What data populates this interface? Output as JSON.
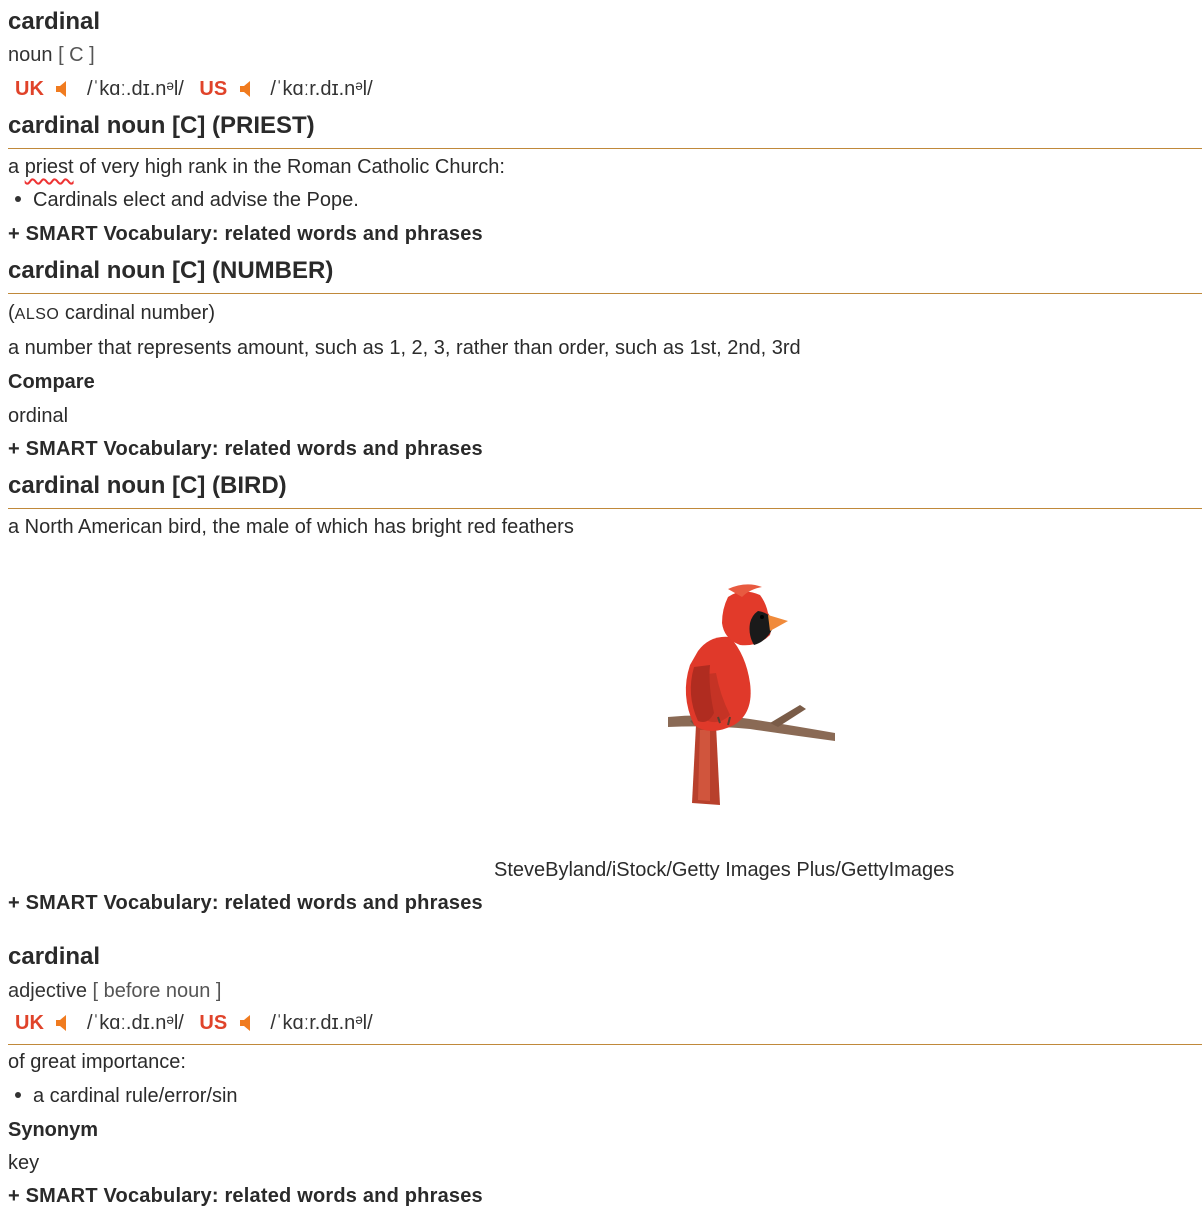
{
  "entry1": {
    "headword": "cardinal",
    "pos": "noun",
    "gram": "[ C ]",
    "uk_label": "UK",
    "uk_ipa": "/ˈkɑː.dɪ.nᵊl/",
    "us_label": "US",
    "us_ipa": "/ˈkɑːr.dɪ.nᵊl/",
    "senses": [
      {
        "heading": "cardinal noun [C] (PRIEST)",
        "def_pre": "a ",
        "def_link": "priest",
        "def_post": " of very high rank in the Roman Catholic Church:",
        "example": "Cardinals elect and advise the Pope.",
        "smart": "+ SMART Vocabulary: related words and phrases"
      },
      {
        "heading": "cardinal noun [C] (NUMBER)",
        "also_open": "(",
        "also_key": "ALSO",
        "also_rest": " cardinal number)",
        "definition": "a number that represents amount, such as 1, 2, 3, rather than order, such as 1st, 2nd, 3rd",
        "compare_label": "Compare",
        "compare_word": "ordinal",
        "smart": "+ SMART Vocabulary: related words and phrases"
      },
      {
        "heading": "cardinal noun [C] (BIRD)",
        "definition": "a North American bird, the male of which has bright red feathers",
        "image_credit": "SteveByland/iStock/Getty Images Plus/GettyImages",
        "smart": "+ SMART Vocabulary: related words and phrases"
      }
    ]
  },
  "entry2": {
    "headword": "cardinal",
    "pos": "adjective",
    "gram": "[ before noun ]",
    "uk_label": "UK",
    "uk_ipa": "/ˈkɑː.dɪ.nᵊl/",
    "us_label": "US",
    "us_ipa": "/ˈkɑːr.dɪ.nᵊl/",
    "definition": "of great importance:",
    "example": "a cardinal rule/error/sin",
    "synonym_label": "Synonym",
    "synonym_word": "key",
    "smart": "+ SMART Vocabulary: related words and phrases"
  },
  "icons": {
    "speaker": "speaker-icon"
  },
  "colors": {
    "region": "#e0432a",
    "speaker": "#f07b1f",
    "rule": "#c0893a"
  }
}
